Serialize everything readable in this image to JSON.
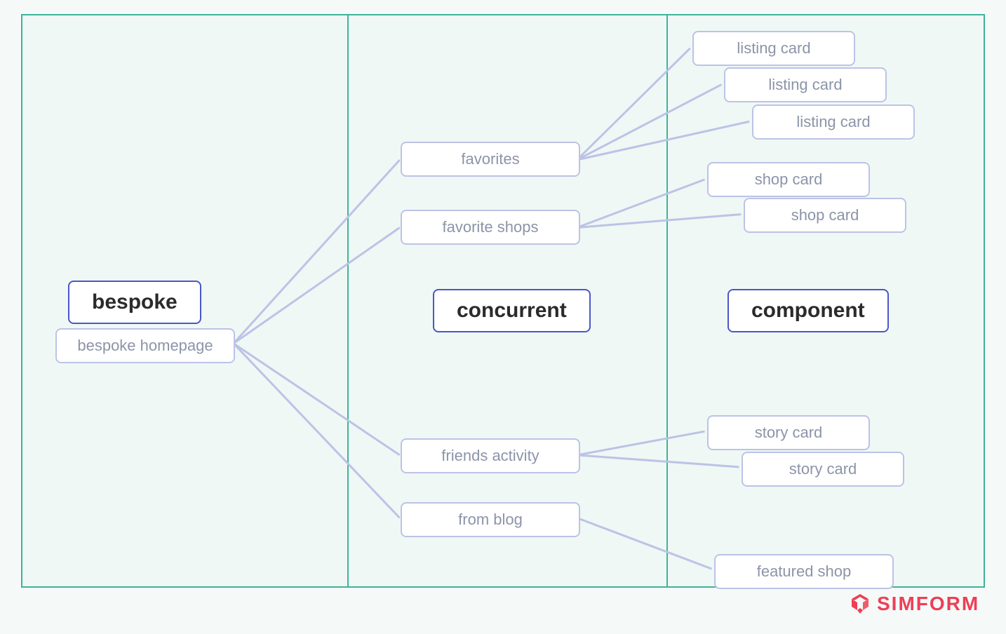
{
  "columns": {
    "bespoke": {
      "header": "bespoke"
    },
    "concurrent": {
      "header": "concurrent"
    },
    "component": {
      "header": "component"
    }
  },
  "nodes": {
    "bespoke_homepage": "bespoke homepage",
    "favorites": "favorites",
    "favorite_shops": "favorite shops",
    "friends_activity": "friends activity",
    "from_blog": "from blog",
    "listing_card_1": "listing card",
    "listing_card_2": "listing card",
    "listing_card_3": "listing card",
    "shop_card_1": "shop card",
    "shop_card_2": "shop card",
    "story_card_1": "story card",
    "story_card_2": "story card",
    "featured_shop": "featured shop"
  },
  "brand": "SIMFORM"
}
